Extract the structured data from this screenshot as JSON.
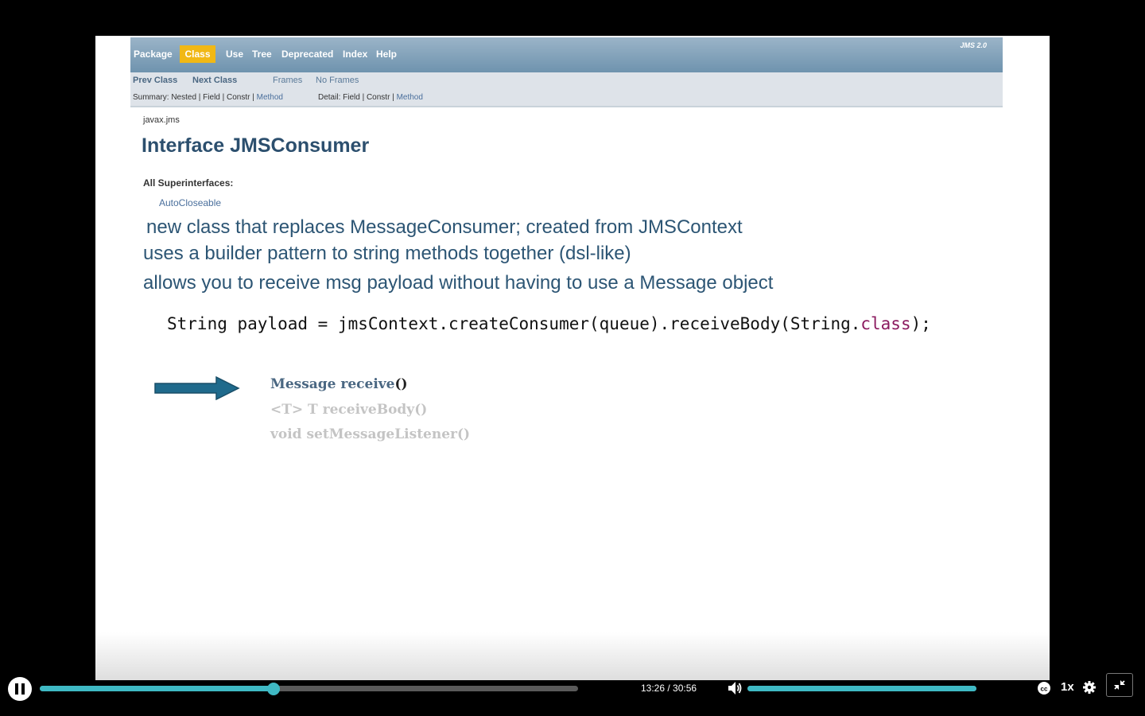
{
  "nav": {
    "items": [
      "Package",
      "Class",
      "Use",
      "Tree",
      "Deprecated",
      "Index",
      "Help"
    ],
    "active": "Class",
    "version": "JMS 2.0"
  },
  "subnav": {
    "prev_class": "Prev Class",
    "next_class": "Next Class",
    "frames": "Frames",
    "no_frames": "No Frames",
    "summary_prefix": "Summary: Nested | Field | Constr | ",
    "summary_method": "Method",
    "detail_prefix": "Detail: Field | Constr | ",
    "detail_method": "Method"
  },
  "doc": {
    "package": "javax.jms",
    "title": "Interface JMSConsumer",
    "superinterfaces_label": "All Superinterfaces:",
    "superinterfaces_value": "AutoCloseable"
  },
  "bullets": [
    "new class that replaces MessageConsumer; created from JMSContext",
    "uses a builder pattern to string methods together (dsl-like)",
    "allows you to receive msg payload without having to use a Message object"
  ],
  "code": {
    "prefix": "String payload = jmsContext.createConsumer(queue).receiveBody(String.",
    "keyword": "class",
    "suffix": ");"
  },
  "methods": {
    "m1_name": "Message receive",
    "m1_parens": "()",
    "m2": "<T> T receiveBody()",
    "m3": "void setMessageListener()"
  },
  "player": {
    "current_time": "13:26",
    "separator": " / ",
    "duration": "30:56",
    "progress_fraction": 0.434,
    "volume_fraction": 1.0,
    "speed": "1x",
    "accent_color": "#3fb9c4"
  }
}
